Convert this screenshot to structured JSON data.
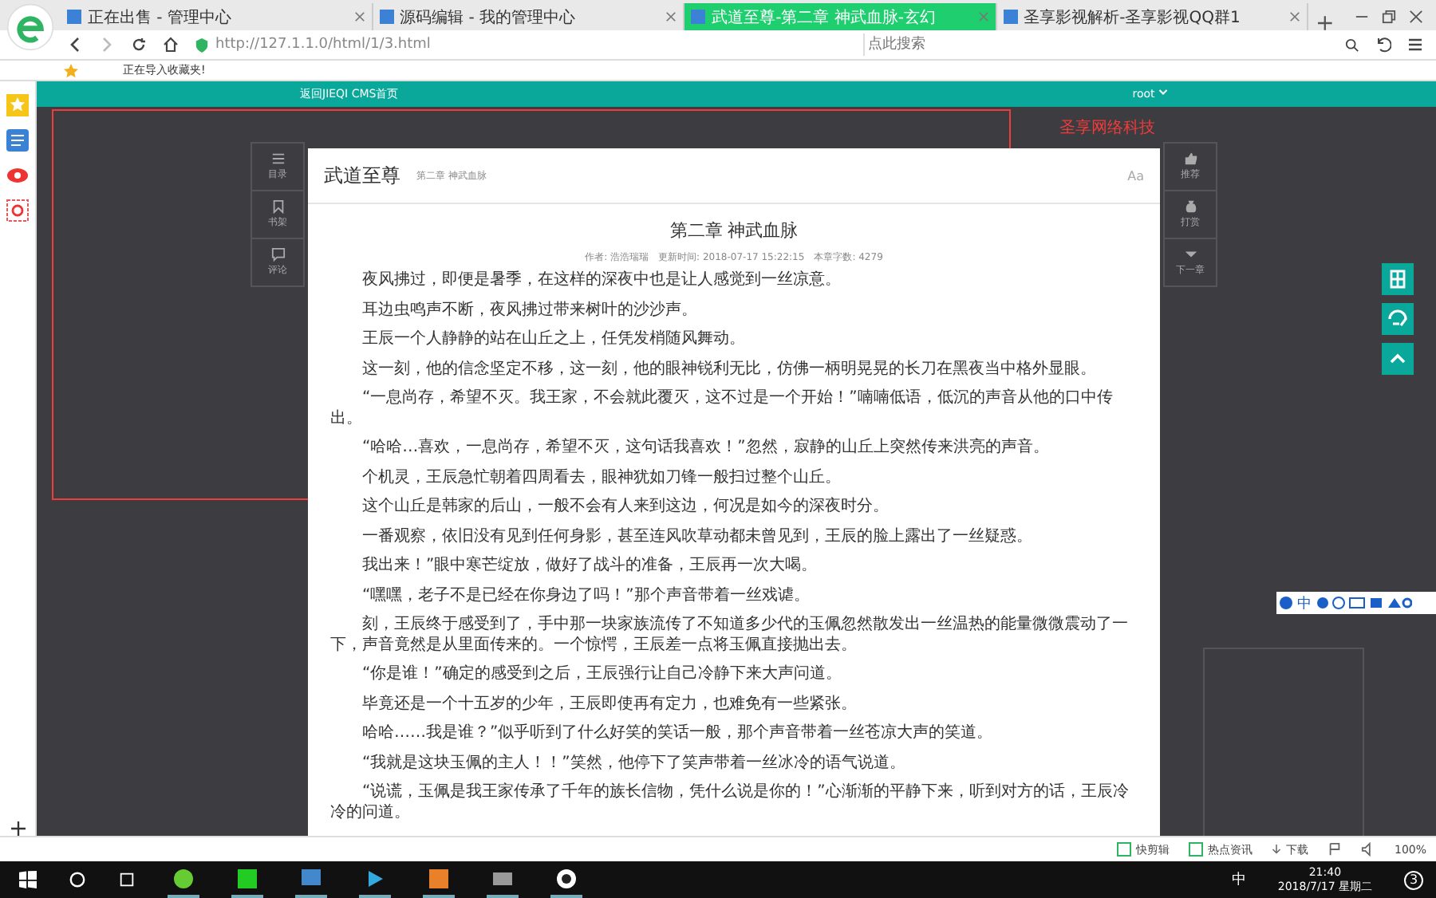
{
  "browser": {
    "tabs": [
      {
        "label": "正在出售 - 管理中心",
        "selected": false
      },
      {
        "label": "源码编辑 - 我的管理中心",
        "selected": false
      },
      {
        "label": "武道至尊-第二章 神武血脉-玄幻",
        "selected": true
      },
      {
        "label": "圣享影视解析-圣享影视QQ群1",
        "selected": false
      }
    ],
    "address": "http://127.1.1.0/html/1/3.html",
    "search_placeholder": "点此搜索",
    "bookmark_notice": "正在导入收藏夹!"
  },
  "site_nav": {
    "home_link": "返回JIEQI CMS首页",
    "user": "root"
  },
  "annotation_label": "圣享网络科技",
  "left_menu": [
    {
      "label": "目录",
      "kind": "list"
    },
    {
      "label": "书架",
      "kind": "bookmark"
    },
    {
      "label": "评论",
      "kind": "comment"
    }
  ],
  "right_menu": [
    {
      "label": "推荐",
      "kind": "thumb"
    },
    {
      "label": "打赏",
      "kind": "money"
    },
    {
      "label": "下一章",
      "kind": "next"
    }
  ],
  "reader": {
    "book_title": "武道至尊",
    "chapter_crumb": "第二章 神武血脉",
    "font_button": "Aa",
    "chapter_title": "第二章 神武血脉",
    "meta": "作者: 浩浩瑞瑞　更新时间: 2018-07-17 15:22:15　本章字数: 4279",
    "paragraphs": [
      "夜风拂过，即便是暑季，在这样的深夜中也是让人感觉到一丝凉意。",
      "耳边虫鸣声不断，夜风拂过带来树叶的沙沙声。",
      "王辰一个人静静的站在山丘之上，任凭发梢随风舞动。",
      "这一刻，他的信念坚定不移，这一刻，他的眼神锐利无比，仿佛一柄明晃晃的长刀在黑夜当中格外显眼。",
      "“一息尚存，希望不灭。我王家，不会就此覆灭，这不过是一个开始！”喃喃低语，低沉的声音从他的口中传出。",
      "“哈哈…喜欢，一息尚存，希望不灭，这句话我喜欢！”忽然，寂静的山丘上突然传来洪亮的声音。",
      "个机灵，王辰急忙朝着四周看去，眼神犹如刀锋一般扫过整个山丘。",
      "这个山丘是韩家的后山，一般不会有人来到这边，何况是如今的深夜时分。",
      "一番观察，依旧没有见到任何身影，甚至连风吹草动都未曾见到，王辰的脸上露出了一丝疑惑。",
      "我出来！”眼中寒芒绽放，做好了战斗的准备，王辰再一次大喝。",
      "“嘿嘿，老子不是已经在你身边了吗！”那个声音带着一丝戏谑。",
      "刻，王辰终于感受到了，手中那一块家族流传了不知道多少代的玉佩忽然散发出一丝温热的能量微微震动了一下，声音竟然是从里面传来的。一个惊愕，王辰差一点将玉佩直接抛出去。",
      "“你是谁！”确定的感受到之后，王辰强行让自己冷静下来大声问道。",
      "毕竟还是一个十五岁的少年，王辰即使再有定力，也难免有一些紧张。",
      "哈哈……我是谁？”似乎听到了什么好笑的笑话一般，那个声音带着一丝苍凉大声的笑道。",
      "“我就是这块玉佩的主人！！”笑然，他停下了笑声带着一丝冰冷的语气说道。",
      "“说谎，玉佩是我王家传承了千年的族长信物，凭什么说是你的！”心渐渐的平静下来，听到对方的话，王辰冷冷的问道。"
    ]
  },
  "ime_toolbar": "中",
  "status_bar": {
    "items": [
      "快剪辑",
      "热点资讯"
    ],
    "download": "下载",
    "zoom": "100%"
  },
  "taskbar": {
    "ime": "中",
    "time": "21:40",
    "date": "2018/7/17 星期二",
    "notifications": "3"
  }
}
